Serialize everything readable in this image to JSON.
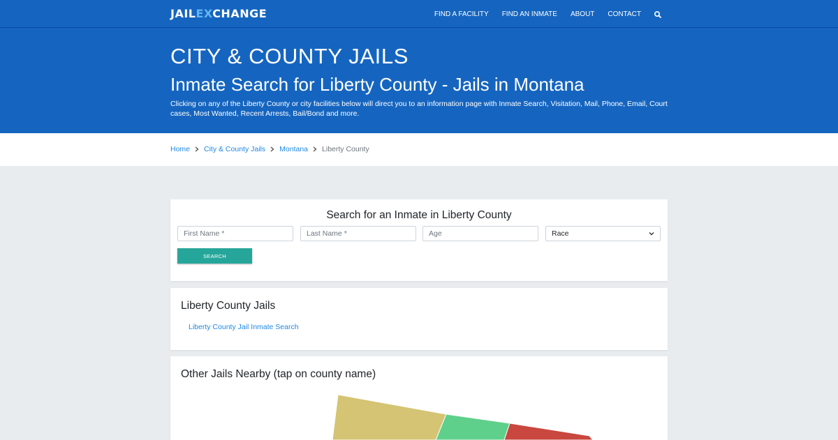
{
  "brand": {
    "logo_left": "JAIL",
    "logo_accent": "EX",
    "logo_right": "CHANGE"
  },
  "nav": {
    "links": [
      "FIND A FACILITY",
      "FIND AN INMATE",
      "ABOUT",
      "CONTACT"
    ],
    "search_icon": "search-icon"
  },
  "hero": {
    "kicker": "CITY & COUNTY JAILS",
    "title": "Inmate Search for Liberty County - Jails in Montana",
    "intro": "Clicking on any of the Liberty County or city facilities below will direct you to an information page with Inmate Search, Visitation, Mail, Phone, Email, Court cases, Most Wanted, Recent Arrests, Bail/Bond and more."
  },
  "breadcrumb": [
    "Home",
    "City & County Jails",
    "Montana",
    "Liberty County"
  ],
  "search": {
    "title": "Search for an Inmate in Liberty County",
    "first_placeholder": "First Name *",
    "last_placeholder": "Last Name *",
    "age_placeholder": "Age",
    "race_selected": "Race",
    "button": "SEARCH"
  },
  "jails": {
    "title": "Liberty County Jails",
    "items": [
      "Liberty County Jail Inmate Search"
    ]
  },
  "nearby": {
    "title": "Other Jails Nearby (tap on county name)"
  },
  "colors": {
    "primary": "#1565c0",
    "link": "#1e88e5",
    "button": "#26a69a",
    "page_bg": "#e9ecef",
    "map_county_1": "#d4c473",
    "map_county_2": "#5fd08b",
    "map_county_3": "#c9473f"
  }
}
